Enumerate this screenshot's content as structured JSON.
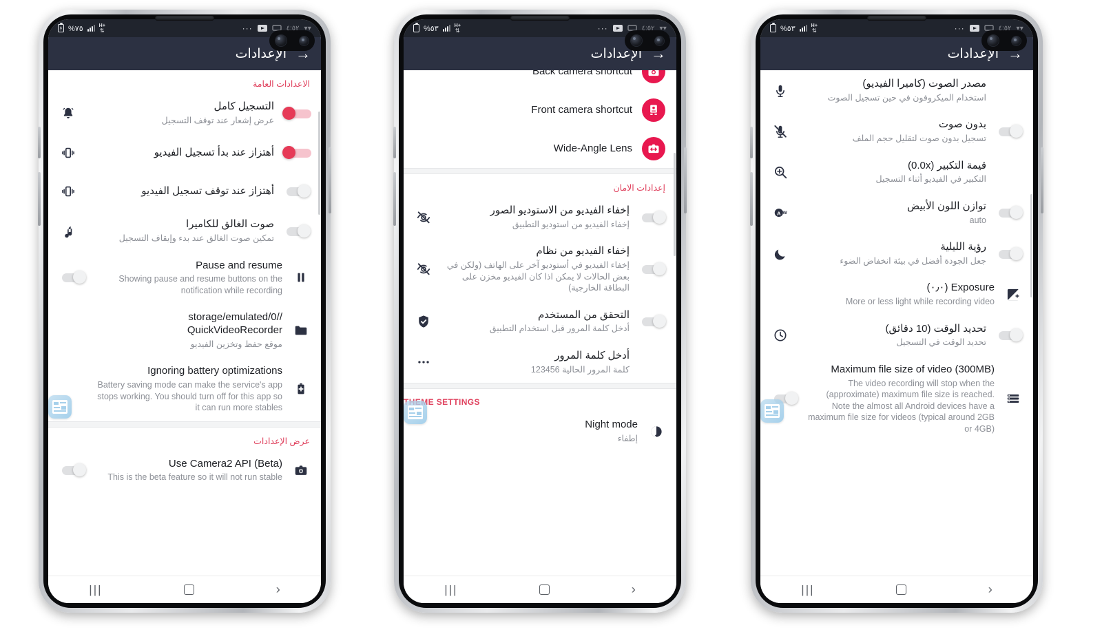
{
  "app": {
    "title": "الإعدادات",
    "accent": "#e0435f",
    "pink": "#e8184f",
    "appbar_bg": "#2c3142",
    "status_bg": "#20242d"
  },
  "phones": [
    {
      "id": "phone-1",
      "status": {
        "battery_pct": "%٧٥",
        "network": "H+",
        "dots": "···"
      },
      "sections": [
        {
          "header": "الاعدادات العامة",
          "dir": "rtl",
          "rows": [
            {
              "icon": "bell-icon",
              "title": "التسجيل كامل",
              "subtitle": "عرض إشعار عند توقف التسجيل",
              "toggle": "on",
              "dir": "rtl"
            },
            {
              "icon": "vibrate-icon",
              "title": "أهتزاز عند بدأ تسجيل الفيديو",
              "subtitle": "",
              "toggle": "on",
              "dir": "rtl"
            },
            {
              "icon": "vibrate-icon",
              "title": "أهتزاز عند توقف تسجيل الفيديو",
              "subtitle": "",
              "toggle": "off",
              "dir": "rtl"
            },
            {
              "icon": "music-note-icon",
              "title": "صوت الغالق للكاميرا",
              "subtitle": "تمكين صوت الغالق عند بدء وإيقاف التسجيل",
              "toggle": "off",
              "dir": "rtl"
            },
            {
              "icon": "pause-icon",
              "title": "Pause and resume",
              "subtitle": "Showing pause and resume buttons on the notification while recording",
              "toggle": "off",
              "dir": "ltr"
            },
            {
              "icon": "folder-icon",
              "title": "storage/emulated/0// QuickVideoRecorder",
              "subtitle": "موقع حفظ وتخزين الفيديو",
              "toggle": "none",
              "dir": "ltr"
            },
            {
              "icon": "battery-plus-icon",
              "title": "Ignoring battery optimizations",
              "subtitle": "Battery saving mode can make the service's app stops working. You should turn off for this app so it can run more stables",
              "toggle": "none",
              "dir": "ltr"
            }
          ]
        },
        {
          "header": "عرض الإعدادات",
          "dir": "rtl",
          "rows": [
            {
              "icon": "camera-icon",
              "title": "Use Camera2 API (Beta)",
              "subtitle": "This is the beta feature so it will not run stable",
              "toggle": "off",
              "dir": "ltr"
            }
          ]
        }
      ]
    },
    {
      "id": "phone-2",
      "status": {
        "battery_pct": "%٥٣",
        "network": "H+",
        "dots": "···"
      },
      "sections": [
        {
          "header": "",
          "dir": "ltr",
          "rows": [
            {
              "icon": "back-camera-circle-icon",
              "title": "Back camera shortcut",
              "subtitle": "",
              "toggle": "none",
              "dir": "ltr",
              "circle": true,
              "clipped": true
            },
            {
              "icon": "front-camera-circle-icon",
              "title": "Front camera shortcut",
              "subtitle": "",
              "toggle": "none",
              "dir": "ltr",
              "circle": true
            },
            {
              "icon": "wide-angle-circle-icon",
              "title": "Wide-Angle Lens",
              "subtitle": "",
              "toggle": "none",
              "dir": "ltr",
              "circle": true
            }
          ]
        },
        {
          "header": "إعدادات الامان",
          "dir": "rtl",
          "rows": [
            {
              "icon": "eye-off-icon",
              "title": "إخفاء الفيديو من الاستوديو الصور",
              "subtitle": "إخفاء الفيديو من استوديو التطبيق",
              "toggle": "off",
              "dir": "rtl"
            },
            {
              "icon": "eye-off-icon",
              "title": "إخفاء الفيديو من نظام",
              "subtitle": "إخفاء الفيديو في أستوديو آخر على الهاتف (ولكن في بعض الحالات لا يمكن اذا كان الفيديو مخزن على البطاقة الخارجية)",
              "toggle": "off",
              "dir": "rtl"
            },
            {
              "icon": "shield-check-icon",
              "title": "التحقق من المستخدم",
              "subtitle": "أدخل كلمة المرور قبل استخدام التطبيق",
              "toggle": "off",
              "dir": "rtl"
            },
            {
              "icon": "more-dots-icon",
              "title": "أدخل كلمة المرور",
              "subtitle": "كلمة المرور الحالية 123456",
              "toggle": "none",
              "dir": "rtl"
            }
          ]
        },
        {
          "header": "THEME SETTINGS",
          "dir": "ltr",
          "rows": [
            {
              "icon": "night-mode-icon",
              "title": "Night mode",
              "subtitle": "إطفاء",
              "toggle": "none",
              "dir": "ltr"
            }
          ]
        }
      ]
    },
    {
      "id": "phone-3",
      "status": {
        "battery_pct": "%٥٣",
        "network": "H+",
        "dots": "···"
      },
      "sections": [
        {
          "header": "",
          "dir": "rtl",
          "rows": [
            {
              "icon": "microphone-icon",
              "title": "مصدر الصوت (كاميرا الفيديو)",
              "subtitle": "استخدام الميكروفون في حين تسجيل الصوت",
              "toggle": "none",
              "dir": "rtl"
            },
            {
              "icon": "microphone-off-icon",
              "title": "بدون صوت",
              "subtitle": "تسجيل بدون صوت لتقليل حجم الملف",
              "toggle": "off",
              "dir": "rtl"
            },
            {
              "icon": "zoom-icon",
              "title": "قيمة التكبير (0.0x)",
              "subtitle": "التكبير في الفيديو أثناء التسجيل",
              "toggle": "none",
              "dir": "rtl"
            },
            {
              "icon": "white-balance-icon",
              "title": "توازن اللون الأبيض",
              "subtitle": "auto",
              "toggle": "off",
              "dir": "rtl"
            },
            {
              "icon": "moon-icon",
              "title": "رؤية الليلية",
              "subtitle": "جعل الجودة أفضل في بيئة انخفاض الضوء",
              "toggle": "off",
              "dir": "rtl"
            },
            {
              "icon": "exposure-icon",
              "title": "(٠٫٠) Exposure",
              "subtitle": "More or less light while recording video",
              "toggle": "none",
              "dir": "ltr"
            },
            {
              "icon": "clock-icon",
              "title": "تحديد الوقت (10 دقائق)",
              "subtitle": "تحديد الوقت في التسجيل",
              "toggle": "off",
              "dir": "rtl"
            },
            {
              "icon": "list-icon",
              "title": "Maximum file size of video (300MB)",
              "subtitle": "The video recording will stop when the (approximate) maximum file size is reached. Note the almost all Android devices have a maximum file size for videos (typical around 2GB or 4GB)",
              "toggle": "off",
              "dir": "ltr"
            }
          ]
        }
      ]
    }
  ],
  "navbar": {
    "recents": "|||",
    "home": "home-square",
    "back": "›"
  }
}
